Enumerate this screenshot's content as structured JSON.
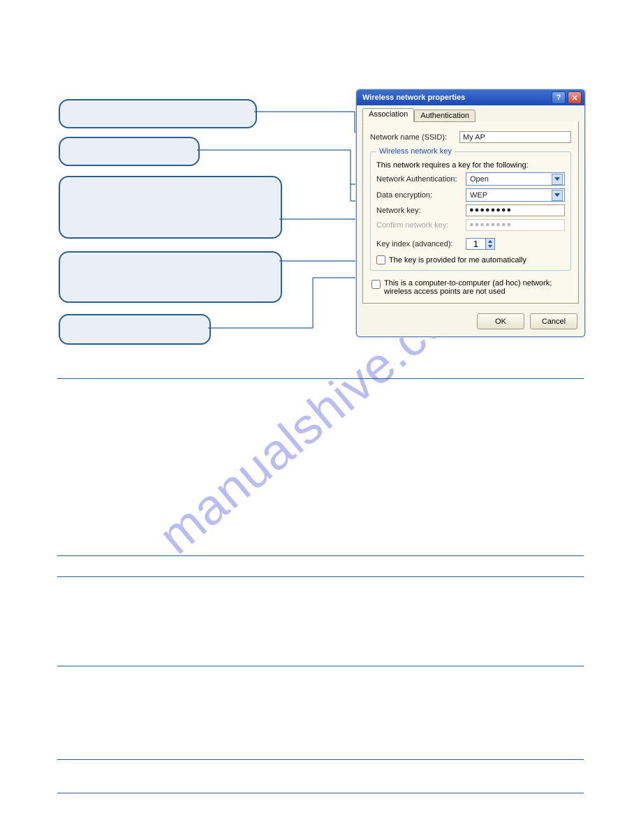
{
  "watermark": "manualshive.com",
  "dialog": {
    "title": "Wireless network properties",
    "tabs": {
      "association": "Association",
      "authentication": "Authentication"
    },
    "ssid_label": "Network name (SSID):",
    "ssid_value": "My AP",
    "wkey_legend": "Wireless network key",
    "wkey_intro": "This network requires a key for the following:",
    "auth_label": "Network Authentication:",
    "auth_value": "Open",
    "enc_label": "Data encryption:",
    "enc_value": "WEP",
    "key_label": "Network key:",
    "key_value": "●●●●●●●●",
    "confirm_label": "Confirm network key:",
    "confirm_value": "●●●●●●●●",
    "keyindex_label": "Key index (advanced):",
    "keyindex_value": "1",
    "autokey_label": "The key is provided for me automatically",
    "adhoc_label": "This is a computer-to-computer (ad hoc) network; wireless access points are not used",
    "ok": "OK",
    "cancel": "Cancel"
  }
}
